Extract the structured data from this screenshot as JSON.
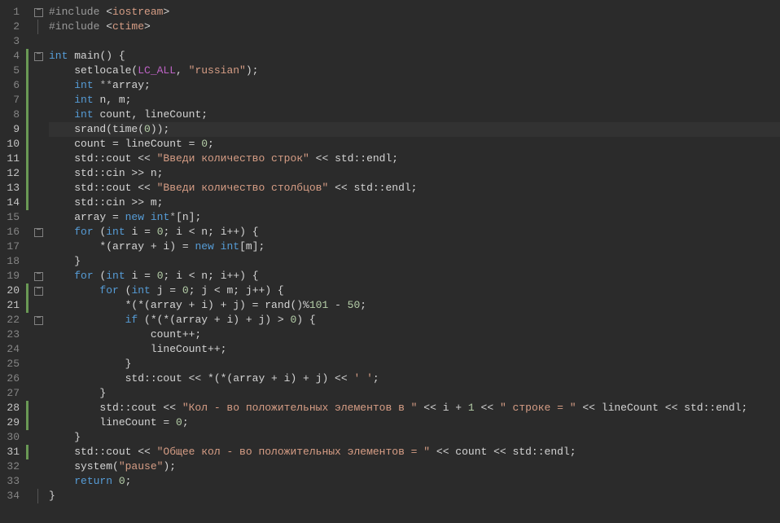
{
  "lines": [
    {
      "n": 1,
      "hl": false,
      "mark": false,
      "fold": "box",
      "cur": false,
      "tokens": [
        [
          "t-pp",
          "#include "
        ],
        [
          "t-pun",
          "<"
        ],
        [
          "t-str",
          "iostream"
        ],
        [
          "t-pun",
          ">"
        ]
      ]
    },
    {
      "n": 2,
      "hl": false,
      "mark": false,
      "fold": "line",
      "cur": false,
      "tokens": [
        [
          "t-pp",
          "#include "
        ],
        [
          "t-pun",
          "<"
        ],
        [
          "t-str",
          "ctime"
        ],
        [
          "t-pun",
          ">"
        ]
      ]
    },
    {
      "n": 3,
      "hl": false,
      "mark": false,
      "fold": "",
      "cur": false,
      "tokens": []
    },
    {
      "n": 4,
      "hl": false,
      "mark": true,
      "fold": "box",
      "cur": false,
      "tokens": [
        [
          "t-kw",
          "int "
        ],
        [
          "t-fn",
          "main"
        ],
        [
          "t-pun",
          "() {"
        ]
      ]
    },
    {
      "n": 5,
      "hl": false,
      "mark": true,
      "fold": "",
      "cur": false,
      "tokens": [
        [
          "t-id",
          "    setlocale("
        ],
        [
          "t-mac",
          "LC_ALL"
        ],
        [
          "t-pun",
          ", "
        ],
        [
          "t-str",
          "\"russian\""
        ],
        [
          "t-pun",
          ");"
        ]
      ]
    },
    {
      "n": 6,
      "hl": false,
      "mark": true,
      "fold": "",
      "cur": false,
      "tokens": [
        [
          "t-id",
          "    "
        ],
        [
          "t-kw",
          "int "
        ],
        [
          "t-op",
          "**"
        ],
        [
          "t-id",
          "array;"
        ]
      ]
    },
    {
      "n": 7,
      "hl": false,
      "mark": true,
      "fold": "",
      "cur": false,
      "tokens": [
        [
          "t-id",
          "    "
        ],
        [
          "t-kw",
          "int "
        ],
        [
          "t-id",
          "n, m;"
        ]
      ]
    },
    {
      "n": 8,
      "hl": false,
      "mark": true,
      "fold": "",
      "cur": false,
      "tokens": [
        [
          "t-id",
          "    "
        ],
        [
          "t-kw",
          "int "
        ],
        [
          "t-id",
          "count, lineCount;"
        ]
      ]
    },
    {
      "n": 9,
      "hl": true,
      "mark": true,
      "fold": "",
      "cur": true,
      "tokens": [
        [
          "t-id",
          "    srand(time("
        ],
        [
          "t-num",
          "0"
        ],
        [
          "t-id",
          "));"
        ]
      ]
    },
    {
      "n": 10,
      "hl": true,
      "mark": true,
      "fold": "",
      "cur": false,
      "tokens": [
        [
          "t-id",
          "    count = lineCount = "
        ],
        [
          "t-num",
          "0"
        ],
        [
          "t-pun",
          ";"
        ]
      ]
    },
    {
      "n": 11,
      "hl": true,
      "mark": true,
      "fold": "",
      "cur": false,
      "tokens": [
        [
          "t-id",
          "    std::cout << "
        ],
        [
          "t-str",
          "\"Введи количество строк\""
        ],
        [
          "t-id",
          " << std::endl;"
        ]
      ]
    },
    {
      "n": 12,
      "hl": true,
      "mark": true,
      "fold": "",
      "cur": false,
      "tokens": [
        [
          "t-id",
          "    std::cin >> n;"
        ]
      ]
    },
    {
      "n": 13,
      "hl": true,
      "mark": true,
      "fold": "",
      "cur": false,
      "tokens": [
        [
          "t-id",
          "    std::cout << "
        ],
        [
          "t-str",
          "\"Введи количество столбцов\""
        ],
        [
          "t-id",
          " << std::endl;"
        ]
      ]
    },
    {
      "n": 14,
      "hl": true,
      "mark": true,
      "fold": "",
      "cur": false,
      "tokens": [
        [
          "t-id",
          "    std::cin >> m;"
        ]
      ]
    },
    {
      "n": 15,
      "hl": false,
      "mark": false,
      "fold": "",
      "cur": false,
      "tokens": [
        [
          "t-id",
          "    array = "
        ],
        [
          "t-kw",
          "new "
        ],
        [
          "t-kw",
          "int"
        ],
        [
          "t-op",
          "*"
        ],
        [
          "t-pun",
          "[n];"
        ]
      ]
    },
    {
      "n": 16,
      "hl": false,
      "mark": false,
      "fold": "box",
      "cur": false,
      "tokens": [
        [
          "t-id",
          "    "
        ],
        [
          "t-kw",
          "for "
        ],
        [
          "t-pun",
          "("
        ],
        [
          "t-kw",
          "int "
        ],
        [
          "t-id",
          "i = "
        ],
        [
          "t-num",
          "0"
        ],
        [
          "t-pun",
          "; i < n; i++) {"
        ]
      ]
    },
    {
      "n": 17,
      "hl": false,
      "mark": false,
      "fold": "",
      "cur": false,
      "tokens": [
        [
          "t-id",
          "        *(array + i) = "
        ],
        [
          "t-kw",
          "new "
        ],
        [
          "t-kw",
          "int"
        ],
        [
          "t-pun",
          "[m];"
        ]
      ]
    },
    {
      "n": 18,
      "hl": false,
      "mark": false,
      "fold": "",
      "cur": false,
      "tokens": [
        [
          "t-id",
          "    }"
        ]
      ]
    },
    {
      "n": 19,
      "hl": false,
      "mark": false,
      "fold": "box",
      "cur": false,
      "tokens": [
        [
          "t-id",
          "    "
        ],
        [
          "t-kw",
          "for "
        ],
        [
          "t-pun",
          "("
        ],
        [
          "t-kw",
          "int "
        ],
        [
          "t-id",
          "i = "
        ],
        [
          "t-num",
          "0"
        ],
        [
          "t-pun",
          "; i < n; i++) {"
        ]
      ]
    },
    {
      "n": 20,
      "hl": true,
      "mark": true,
      "fold": "box",
      "cur": false,
      "tokens": [
        [
          "t-id",
          "        "
        ],
        [
          "t-kw",
          "for "
        ],
        [
          "t-pun",
          "("
        ],
        [
          "t-kw",
          "int "
        ],
        [
          "t-id",
          "j = "
        ],
        [
          "t-num",
          "0"
        ],
        [
          "t-pun",
          "; j < m; j++) {"
        ]
      ]
    },
    {
      "n": 21,
      "hl": true,
      "mark": true,
      "fold": "",
      "cur": false,
      "tokens": [
        [
          "t-id",
          "            *(*(array + i) + j) = rand()%"
        ],
        [
          "t-num",
          "101"
        ],
        [
          "t-id",
          " - "
        ],
        [
          "t-num",
          "50"
        ],
        [
          "t-pun",
          ";"
        ]
      ]
    },
    {
      "n": 22,
      "hl": false,
      "mark": false,
      "fold": "box",
      "cur": false,
      "tokens": [
        [
          "t-id",
          "            "
        ],
        [
          "t-kw",
          "if "
        ],
        [
          "t-pun",
          "(*(*(array + i) + j) > "
        ],
        [
          "t-num",
          "0"
        ],
        [
          "t-pun",
          ") {"
        ]
      ]
    },
    {
      "n": 23,
      "hl": false,
      "mark": false,
      "fold": "",
      "cur": false,
      "tokens": [
        [
          "t-id",
          "                count++;"
        ]
      ]
    },
    {
      "n": 24,
      "hl": false,
      "mark": false,
      "fold": "",
      "cur": false,
      "tokens": [
        [
          "t-id",
          "                lineCount++;"
        ]
      ]
    },
    {
      "n": 25,
      "hl": false,
      "mark": false,
      "fold": "",
      "cur": false,
      "tokens": [
        [
          "t-id",
          "            }"
        ]
      ]
    },
    {
      "n": 26,
      "hl": false,
      "mark": false,
      "fold": "",
      "cur": false,
      "tokens": [
        [
          "t-id",
          "            std::cout << *(*(array + i) + j) << "
        ],
        [
          "t-str",
          "' '"
        ],
        [
          "t-pun",
          ";"
        ]
      ]
    },
    {
      "n": 27,
      "hl": false,
      "mark": false,
      "fold": "",
      "cur": false,
      "tokens": [
        [
          "t-id",
          "        }"
        ]
      ]
    },
    {
      "n": 28,
      "hl": true,
      "mark": true,
      "fold": "",
      "cur": false,
      "tokens": [
        [
          "t-id",
          "        std::cout << "
        ],
        [
          "t-str",
          "\"Кол - во положительных элементов в \""
        ],
        [
          "t-id",
          " << i + "
        ],
        [
          "t-num",
          "1"
        ],
        [
          "t-id",
          " << "
        ],
        [
          "t-str",
          "\" строке = \""
        ],
        [
          "t-id",
          " << lineCount << std::endl;"
        ]
      ]
    },
    {
      "n": 29,
      "hl": true,
      "mark": true,
      "fold": "",
      "cur": false,
      "tokens": [
        [
          "t-id",
          "        lineCount = "
        ],
        [
          "t-num",
          "0"
        ],
        [
          "t-pun",
          ";"
        ]
      ]
    },
    {
      "n": 30,
      "hl": false,
      "mark": false,
      "fold": "",
      "cur": false,
      "tokens": [
        [
          "t-id",
          "    }"
        ]
      ]
    },
    {
      "n": 31,
      "hl": true,
      "mark": true,
      "fold": "",
      "cur": false,
      "tokens": [
        [
          "t-id",
          "    std::cout << "
        ],
        [
          "t-str",
          "\"Общее кол - во положительных элементов = \""
        ],
        [
          "t-id",
          " << count << std::endl;"
        ]
      ]
    },
    {
      "n": 32,
      "hl": false,
      "mark": false,
      "fold": "",
      "cur": false,
      "tokens": [
        [
          "t-id",
          "    system("
        ],
        [
          "t-str",
          "\"pause\""
        ],
        [
          "t-pun",
          ");"
        ]
      ]
    },
    {
      "n": 33,
      "hl": false,
      "mark": false,
      "fold": "",
      "cur": false,
      "tokens": [
        [
          "t-id",
          "    "
        ],
        [
          "t-kw",
          "return "
        ],
        [
          "t-num",
          "0"
        ],
        [
          "t-pun",
          ";"
        ]
      ]
    },
    {
      "n": 34,
      "hl": false,
      "mark": false,
      "fold": "line",
      "cur": false,
      "tokens": [
        [
          "t-pun",
          "}"
        ]
      ]
    }
  ]
}
